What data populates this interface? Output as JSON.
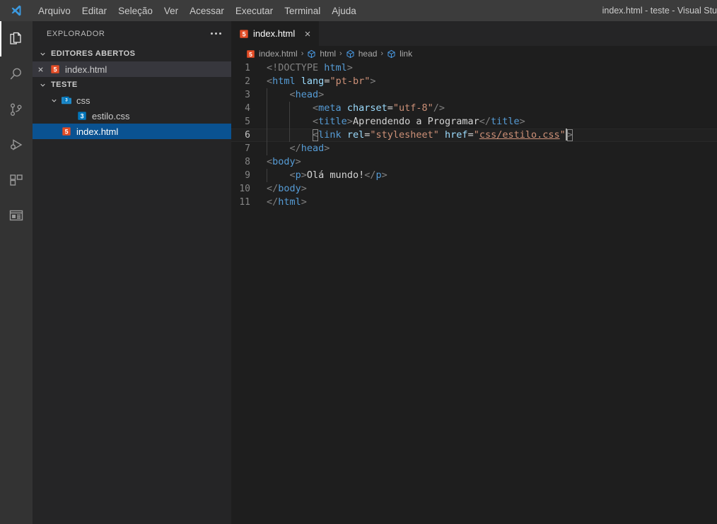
{
  "titlebar": {
    "window_title": "index.html - teste - Visual Stu",
    "logo_icon": "vscode-logo-icon",
    "menu": [
      {
        "label": "Arquivo",
        "name": "menu-arquivo"
      },
      {
        "label": "Editar",
        "name": "menu-editar"
      },
      {
        "label": "Seleção",
        "name": "menu-selecao"
      },
      {
        "label": "Ver",
        "name": "menu-ver"
      },
      {
        "label": "Acessar",
        "name": "menu-acessar"
      },
      {
        "label": "Executar",
        "name": "menu-executar"
      },
      {
        "label": "Terminal",
        "name": "menu-terminal"
      },
      {
        "label": "Ajuda",
        "name": "menu-ajuda"
      }
    ]
  },
  "activitybar": {
    "items": [
      {
        "icon": "files-explorer-icon",
        "active": true
      },
      {
        "icon": "search-icon",
        "active": false
      },
      {
        "icon": "source-control-icon",
        "active": false
      },
      {
        "icon": "run-and-debug-icon",
        "active": false
      },
      {
        "icon": "extensions-icon",
        "active": false
      },
      {
        "icon": "layout-panel-icon",
        "active": false
      }
    ]
  },
  "sidebar": {
    "header_title": "EXPLORADOR",
    "more_actions_icon": "ellipsis-icon",
    "open_editors": {
      "label": "EDITORES ABERTOS",
      "expanded": true,
      "items": [
        {
          "name": "index.html",
          "icon": "html5-file-icon",
          "close_icon": "close-icon",
          "state": "hovered"
        }
      ]
    },
    "project": {
      "label": "TESTE",
      "expanded": true,
      "tree": [
        {
          "name": "css",
          "icon": "css3-folder-icon",
          "type": "folder",
          "depth": 1,
          "expanded": true,
          "selected": false
        },
        {
          "name": "estilo.css",
          "icon": "css3-file-icon",
          "type": "file",
          "depth": 2,
          "selected": false
        },
        {
          "name": "index.html",
          "icon": "html5-file-icon",
          "type": "file",
          "depth": 1,
          "selected": true
        }
      ]
    }
  },
  "editor": {
    "tabs": [
      {
        "label": "index.html",
        "icon": "html5-file-icon",
        "active": true,
        "close_icon": "close-icon"
      }
    ],
    "breadcrumbs": [
      {
        "label": "index.html",
        "icon": "html5-file-icon"
      },
      {
        "label": "html",
        "icon": "symbol-field-icon"
      },
      {
        "label": "head",
        "icon": "symbol-field-icon"
      },
      {
        "label": "link",
        "icon": "symbol-field-icon"
      }
    ],
    "breadcrumb_separator": "›",
    "active_line": 6,
    "lines": [
      {
        "n": 1,
        "indent": 0,
        "tokens": [
          {
            "t": "<!DOCTYPE ",
            "c": "t-gray"
          },
          {
            "t": "html",
            "c": "t-blue"
          },
          {
            "t": ">",
            "c": "t-gray"
          }
        ]
      },
      {
        "n": 2,
        "indent": 0,
        "tokens": [
          {
            "t": "<",
            "c": "t-punct"
          },
          {
            "t": "html",
            "c": "t-tag"
          },
          {
            "t": " ",
            "c": "t-plain"
          },
          {
            "t": "lang",
            "c": "t-attr"
          },
          {
            "t": "=",
            "c": "t-plain"
          },
          {
            "t": "\"pt-br\"",
            "c": "t-str"
          },
          {
            "t": ">",
            "c": "t-punct"
          }
        ]
      },
      {
        "n": 3,
        "indent": 1,
        "tokens": [
          {
            "t": "    <",
            "c": "t-punct"
          },
          {
            "t": "head",
            "c": "t-tag"
          },
          {
            "t": ">",
            "c": "t-punct"
          }
        ]
      },
      {
        "n": 4,
        "indent": 2,
        "tokens": [
          {
            "t": "        <",
            "c": "t-punct"
          },
          {
            "t": "meta",
            "c": "t-tag"
          },
          {
            "t": " ",
            "c": "t-plain"
          },
          {
            "t": "charset",
            "c": "t-attr"
          },
          {
            "t": "=",
            "c": "t-plain"
          },
          {
            "t": "\"utf-8\"",
            "c": "t-str"
          },
          {
            "t": "/>",
            "c": "t-punct"
          }
        ]
      },
      {
        "n": 5,
        "indent": 2,
        "tokens": [
          {
            "t": "        <",
            "c": "t-punct"
          },
          {
            "t": "title",
            "c": "t-tag"
          },
          {
            "t": ">",
            "c": "t-punct"
          },
          {
            "t": "Aprendendo a Programar",
            "c": "t-plain"
          },
          {
            "t": "</",
            "c": "t-punct"
          },
          {
            "t": "title",
            "c": "t-tag"
          },
          {
            "t": ">",
            "c": "t-punct"
          }
        ]
      },
      {
        "n": 6,
        "indent": 2,
        "tokens": [
          {
            "t": "        ",
            "c": "t-plain"
          },
          {
            "t": "<",
            "c": "t-punct",
            "box": true
          },
          {
            "t": "link",
            "c": "t-tag"
          },
          {
            "t": " ",
            "c": "t-plain"
          },
          {
            "t": "rel",
            "c": "t-attr"
          },
          {
            "t": "=",
            "c": "t-plain"
          },
          {
            "t": "\"stylesheet\"",
            "c": "t-str"
          },
          {
            "t": " ",
            "c": "t-plain"
          },
          {
            "t": "href",
            "c": "t-attr"
          },
          {
            "t": "=",
            "c": "t-plain"
          },
          {
            "t": "\"",
            "c": "t-str"
          },
          {
            "t": "css/estilo.css",
            "c": "t-str",
            "underline": true
          },
          {
            "t": "\"",
            "c": "t-str"
          },
          {
            "t": "cursor",
            "c": "cursor"
          },
          {
            "t": ">",
            "c": "t-punct",
            "box": true
          }
        ]
      },
      {
        "n": 7,
        "indent": 1,
        "tokens": [
          {
            "t": "    </",
            "c": "t-punct"
          },
          {
            "t": "head",
            "c": "t-tag"
          },
          {
            "t": ">",
            "c": "t-punct"
          }
        ]
      },
      {
        "n": 8,
        "indent": 0,
        "tokens": [
          {
            "t": "<",
            "c": "t-punct"
          },
          {
            "t": "body",
            "c": "t-tag"
          },
          {
            "t": ">",
            "c": "t-punct"
          }
        ]
      },
      {
        "n": 9,
        "indent": 1,
        "tokens": [
          {
            "t": "    <",
            "c": "t-punct"
          },
          {
            "t": "p",
            "c": "t-tag"
          },
          {
            "t": ">",
            "c": "t-punct"
          },
          {
            "t": "Olá mundo!",
            "c": "t-plain"
          },
          {
            "t": "</",
            "c": "t-punct"
          },
          {
            "t": "p",
            "c": "t-tag"
          },
          {
            "t": ">",
            "c": "t-punct"
          }
        ]
      },
      {
        "n": 10,
        "indent": 0,
        "tokens": [
          {
            "t": "</",
            "c": "t-punct"
          },
          {
            "t": "body",
            "c": "t-tag"
          },
          {
            "t": ">",
            "c": "t-punct"
          }
        ]
      },
      {
        "n": 11,
        "indent": 0,
        "tokens": [
          {
            "t": "</",
            "c": "t-punct"
          },
          {
            "t": "html",
            "c": "t-tag"
          },
          {
            "t": ">",
            "c": "t-punct"
          }
        ]
      }
    ]
  },
  "colors": {
    "titlebar_bg": "#3c3c3c",
    "activitybar_bg": "#333333",
    "sidebar_bg": "#252526",
    "editor_bg": "#1e1e1e",
    "selection_blue": "#0a5291",
    "html_icon": "#e44d26",
    "css_icon": "#0277bd",
    "accent_blue": "#569cd6",
    "string_orange": "#ce9178"
  }
}
